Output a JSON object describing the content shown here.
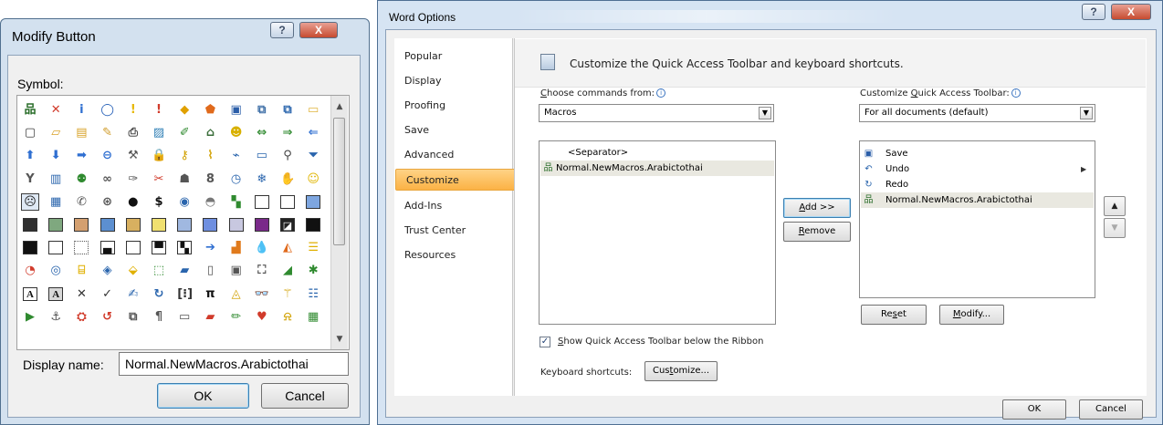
{
  "modify_button": {
    "title": "Modify Button",
    "help_glyph": "?",
    "close_glyph": "X",
    "symbol_label": "Symbol:",
    "display_name_label": "Display name:",
    "display_name_value": "Normal.NewMacros.Arabictothai",
    "ok_label": "OK",
    "cancel_label": "Cancel",
    "selected_index": 48
  },
  "word_options": {
    "title": "Word Options",
    "help_glyph": "?",
    "close_glyph": "X",
    "nav": [
      "Popular",
      "Display",
      "Proofing",
      "Save",
      "Advanced",
      "Customize",
      "Add-Ins",
      "Trust Center",
      "Resources"
    ],
    "selected_nav_index": 5,
    "header": "Customize the Quick Access Toolbar and keyboard shortcuts.",
    "choose_label_u": "C",
    "choose_label_rest": "hoose commands from:",
    "choose_value": "Macros",
    "customize_label_pre": "Customize ",
    "customize_label_u": "Q",
    "customize_label_rest": "uick Access Toolbar:",
    "customize_value": "For all documents (default)",
    "left_list": [
      {
        "label": "<Separator>",
        "icon": ""
      },
      {
        "label": "Normal.NewMacros.Arabictothai",
        "icon": "macro"
      }
    ],
    "right_list": [
      {
        "label": "Save",
        "icon": "save"
      },
      {
        "label": "Undo",
        "icon": "undo"
      },
      {
        "label": "Redo",
        "icon": "redo"
      },
      {
        "label": "Normal.NewMacros.Arabictothai",
        "icon": "macro"
      }
    ],
    "add_u": "A",
    "add_rest": "dd >>",
    "remove_u": "R",
    "remove_rest": "emove",
    "reset_pre": "Re",
    "reset_u": "s",
    "reset_rest": "et",
    "modify_u": "M",
    "modify_rest": "odify...",
    "show_below_u": "S",
    "show_below_rest": "how Quick Access Toolbar below the Ribbon",
    "show_below_checked": true,
    "keyboard_label": "Keyboard shortcuts:",
    "customize_btn_pre": "Cus",
    "customize_btn_u": "t",
    "customize_btn_rest": "omize...",
    "ok_label": "OK",
    "cancel_label": "Cancel",
    "info_glyph": "i",
    "dropdown_glyph": "▼",
    "up_glyph": "▲",
    "down_glyph": "▼",
    "more_glyph": "▶"
  },
  "colors": {
    "accent_nav": "#fbb245",
    "aero_frame": "#d3e1ef",
    "close_red": "#c74b30"
  },
  "icon_names": [
    "macro-icon",
    "error-icon",
    "info-icon",
    "help-icon",
    "warning-icon",
    "exclamation-icon",
    "diamond-icon",
    "shield-icon",
    "save-icon",
    "copy-icon",
    "paste-icon",
    "folder-icon"
  ],
  "symbols": [
    {
      "k": "tree",
      "c": "#2a6e2a",
      "t": "品"
    },
    {
      "k": "err",
      "c": "#d13b2b",
      "t": "✕"
    },
    {
      "k": "info",
      "c": "#2f6fd1",
      "t": "i"
    },
    {
      "k": "ring",
      "c": "#1f5bb5",
      "t": "◯"
    },
    {
      "k": "warn",
      "c": "#e7b800",
      "t": "!"
    },
    {
      "k": "bang",
      "c": "#d13b2b",
      "t": "!"
    },
    {
      "k": "dia",
      "c": "#e0a000",
      "t": "◆"
    },
    {
      "k": "shield",
      "c": "#e06a1c",
      "t": "⬟"
    },
    {
      "k": "disk",
      "c": "#2b5ea8",
      "t": "▣"
    },
    {
      "k": "copy",
      "c": "#3d6ea6",
      "t": "⧉"
    },
    {
      "k": "paste",
      "c": "#2a65ad",
      "t": "⧉"
    },
    {
      "k": "folder",
      "c": "#e0b540",
      "t": "▭"
    },
    {
      "k": "page",
      "c": "#3c3c3c",
      "t": "▢"
    },
    {
      "k": "fopen",
      "c": "#d9a22c",
      "t": "▱"
    },
    {
      "k": "pages",
      "c": "#d8a32a",
      "t": "▤"
    },
    {
      "k": "fedit",
      "c": "#cf9a25",
      "t": "✎"
    },
    {
      "k": "print",
      "c": "#4b4b4b",
      "t": "⎙"
    },
    {
      "k": "img",
      "c": "#2f7fb5",
      "t": "▨"
    },
    {
      "k": "pencil",
      "c": "#2f8a2f",
      "t": "✐"
    },
    {
      "k": "home",
      "c": "#3b6e3b",
      "t": "⌂"
    },
    {
      "k": "smile",
      "c": "#d8b000",
      "t": "☻"
    },
    {
      "k": "arr2",
      "c": "#2f8a2f",
      "t": "⇔"
    },
    {
      "k": "arrR",
      "c": "#2f8a2f",
      "t": "⇒"
    },
    {
      "k": "arrL",
      "c": "#2f6fd1",
      "t": "⇐"
    },
    {
      "k": "up",
      "c": "#2f6fd1",
      "t": "⬆"
    },
    {
      "k": "down",
      "c": "#2f6fd1",
      "t": "⬇"
    },
    {
      "k": "right",
      "c": "#2f6fd1",
      "t": "➡"
    },
    {
      "k": "back",
      "c": "#2f6fd1",
      "t": "⊖"
    },
    {
      "k": "tool",
      "c": "#555555",
      "t": "⚒"
    },
    {
      "k": "lock",
      "c": "#d1a000",
      "t": "🔒"
    },
    {
      "k": "key",
      "c": "#d1a000",
      "t": "⚷"
    },
    {
      "k": "draw",
      "c": "#d1a000",
      "t": "⌇"
    },
    {
      "k": "brush",
      "c": "#2a65ad",
      "t": "⌁"
    },
    {
      "k": "mon",
      "c": "#2a65ad",
      "t": "▭"
    },
    {
      "k": "zoom",
      "c": "#444444",
      "t": "⚲"
    },
    {
      "k": "filter",
      "c": "#2a65ad",
      "t": "⏷"
    },
    {
      "k": "funnel",
      "c": "#555555",
      "t": "Y"
    },
    {
      "k": "book",
      "c": "#2a65ad",
      "t": "▥"
    },
    {
      "k": "people",
      "c": "#2f8a2f",
      "t": "⚉"
    },
    {
      "k": "link",
      "c": "#555555",
      "t": "∞"
    },
    {
      "k": "pen",
      "c": "#555555",
      "t": "✑"
    },
    {
      "k": "cut",
      "c": "#d13b2b",
      "t": "✂"
    },
    {
      "k": "user",
      "c": "#555555",
      "t": "☗"
    },
    {
      "k": "s8",
      "c": "#555555",
      "t": "8"
    },
    {
      "k": "clock",
      "c": "#2a65ad",
      "t": "◷"
    },
    {
      "k": "snow",
      "c": "#2a65ad",
      "t": "❄"
    },
    {
      "k": "hand",
      "c": "#d1a000",
      "t": "✋"
    },
    {
      "k": "happy",
      "c": "#e0b500",
      "t": "☺"
    },
    {
      "k": "sad",
      "c": "#222222",
      "t": "☹"
    },
    {
      "k": "calc",
      "c": "#2a65ad",
      "t": "▦"
    },
    {
      "k": "phone",
      "c": "#555555",
      "t": "✆"
    },
    {
      "k": "coin",
      "c": "#555555",
      "t": "⊛"
    },
    {
      "k": "ball",
      "c": "#111111",
      "t": "●"
    },
    {
      "k": "dollar",
      "c": "#111111",
      "t": "$"
    },
    {
      "k": "eye",
      "c": "#2a65ad",
      "t": "◉"
    },
    {
      "k": "shadow",
      "c": "#777777",
      "t": "◓"
    },
    {
      "k": "tiles",
      "c": "#2f8a2f",
      "t": "▚"
    },
    {
      "k": "sqw",
      "c": "#ffffff",
      "t": ""
    },
    {
      "k": "sqw2",
      "c": "#ffffff",
      "t": ""
    },
    {
      "k": "sqblue",
      "c": "#7ea6e0",
      "t": ""
    },
    {
      "k": "sq",
      "c": "#2f2f2f",
      "t": ""
    },
    {
      "k": "sq",
      "c": "#7fa87f",
      "t": ""
    },
    {
      "k": "sq",
      "c": "#d4a070",
      "t": ""
    },
    {
      "k": "sq",
      "c": "#5c8fd0",
      "t": ""
    },
    {
      "k": "sq",
      "c": "#d8b060",
      "t": ""
    },
    {
      "k": "sq",
      "c": "#f0e070",
      "t": ""
    },
    {
      "k": "sq",
      "c": "#a0b8e0",
      "t": ""
    },
    {
      "k": "sq",
      "c": "#6f8fe0",
      "t": ""
    },
    {
      "k": "sq",
      "c": "#c8c8e0",
      "t": ""
    },
    {
      "k": "sq",
      "c": "#7a2a8a",
      "t": ""
    },
    {
      "k": "sq",
      "c": "#222222",
      "t": "◪"
    },
    {
      "k": "sq",
      "c": "#111111",
      "t": ""
    },
    {
      "k": "sq",
      "c": "#111111",
      "t": ""
    },
    {
      "k": "sqo",
      "c": "#ffffff",
      "t": ""
    },
    {
      "k": "dotted",
      "c": "#ffffff",
      "t": ""
    },
    {
      "k": "halfb",
      "c": "#ffffff",
      "t": "▄"
    },
    {
      "k": "sqo",
      "c": "#ffffff",
      "t": ""
    },
    {
      "k": "halft",
      "c": "#ffffff",
      "t": "▀"
    },
    {
      "k": "checker",
      "c": "#ffffff",
      "t": "▚"
    },
    {
      "k": "go",
      "c": "#2f6fd1",
      "t": "➔"
    },
    {
      "k": "chart",
      "c": "#e07a1c",
      "t": "▟"
    },
    {
      "k": "drop",
      "c": "#2a65ad",
      "t": "💧"
    },
    {
      "k": "area",
      "c": "#e06a1c",
      "t": "◭"
    },
    {
      "k": "bars",
      "c": "#e0b000",
      "t": "☰"
    },
    {
      "k": "pie",
      "c": "#d13b2b",
      "t": "◔"
    },
    {
      "k": "donut",
      "c": "#2a65ad",
      "t": "◎"
    },
    {
      "k": "cyl",
      "c": "#e0b000",
      "t": "⌸"
    },
    {
      "k": "cube",
      "c": "#2a65ad",
      "t": "◈"
    },
    {
      "k": "box3d",
      "c": "#e0b000",
      "t": "⬙"
    },
    {
      "k": "cubes",
      "c": "#2f8a2f",
      "t": "⬚"
    },
    {
      "k": "surface",
      "c": "#2a65ad",
      "t": "▰"
    },
    {
      "k": "doc",
      "c": "#555555",
      "t": "▯"
    },
    {
      "k": "photo",
      "c": "#555555",
      "t": "▣"
    },
    {
      "k": "film",
      "c": "#555555",
      "t": "⛶"
    },
    {
      "k": "wave",
      "c": "#2f8a2f",
      "t": "◢"
    },
    {
      "k": "star",
      "c": "#2f8a2f",
      "t": "✱"
    },
    {
      "k": "A1",
      "c": "#111111",
      "t": "A"
    },
    {
      "k": "A2",
      "c": "#111111",
      "t": "A"
    },
    {
      "k": "x",
      "c": "#333333",
      "t": "✕"
    },
    {
      "k": "check",
      "c": "#333333",
      "t": "✓"
    },
    {
      "k": "sign",
      "c": "#2a65ad",
      "t": "✍"
    },
    {
      "k": "refresh",
      "c": "#2a65ad",
      "t": "↻"
    },
    {
      "k": "matrix",
      "c": "#333333",
      "t": "[⁝]"
    },
    {
      "k": "pi",
      "c": "#111111",
      "t": "π"
    },
    {
      "k": "fill",
      "c": "#d1a000",
      "t": "◬"
    },
    {
      "k": "binoc",
      "c": "#2a65ad",
      "t": "👓"
    },
    {
      "k": "wand",
      "c": "#d1a000",
      "t": "⚚"
    },
    {
      "k": "list",
      "c": "#2a65ad",
      "t": "☷"
    },
    {
      "k": "play",
      "c": "#2f8a2f",
      "t": "▶"
    },
    {
      "k": "anchor",
      "c": "#555555",
      "t": "⚓"
    },
    {
      "k": "share",
      "c": "#d13b2b",
      "t": "⛭"
    },
    {
      "k": "lasso",
      "c": "#d13b2b",
      "t": "↺"
    },
    {
      "k": "copy2",
      "c": "#555555",
      "t": "⧉"
    },
    {
      "k": "pilcrow",
      "c": "#555555",
      "t": "¶"
    },
    {
      "k": "frame",
      "c": "#555555",
      "t": "▭"
    },
    {
      "k": "eraser",
      "c": "#d13b2b",
      "t": "▰"
    },
    {
      "k": "pencil2",
      "c": "#2f8a2f",
      "t": "✏"
    },
    {
      "k": "heart",
      "c": "#d13b2b",
      "t": "♥"
    },
    {
      "k": "bell",
      "c": "#d1a000",
      "t": "⍾"
    },
    {
      "k": "grid",
      "c": "#2f8a2f",
      "t": "▦"
    }
  ]
}
